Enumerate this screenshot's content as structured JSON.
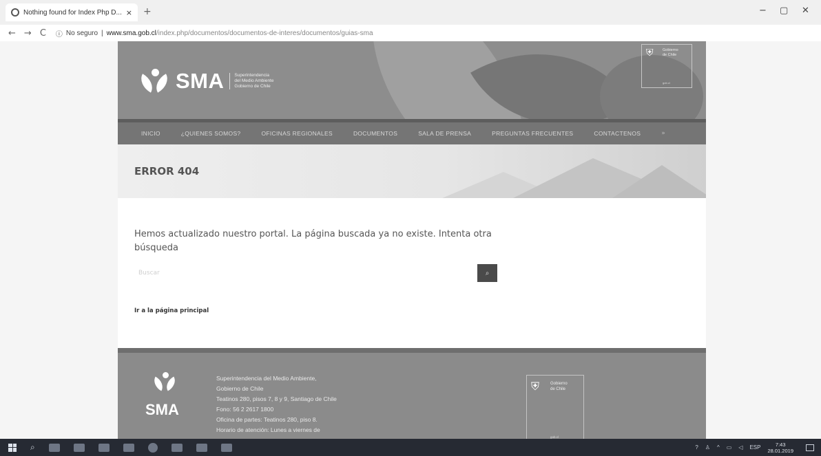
{
  "browser": {
    "tab_title": "Nothing found for Index Php D...",
    "tab_close": "×",
    "new_tab": "+",
    "win_min": "−",
    "win_max": "▢",
    "win_close": "✕",
    "back": "←",
    "forward": "→",
    "reload": "C",
    "security_label": "No seguro",
    "url_domain": "www.sma.gob.cl",
    "url_path": "/index.php/documentos/documentos-de-interes/documentos/guias-sma",
    "star": "☆",
    "ext": "▦",
    "account": "⊖",
    "menu": "⋮"
  },
  "header": {
    "logo_text": "SMA",
    "logo_sub": [
      "Superintendencia",
      "del Medio Ambiente",
      "Gobierno de Chile"
    ],
    "gov_badge": [
      "Gobierno",
      "de Chile"
    ],
    "gov_badge_foot": "gob.cl"
  },
  "nav": {
    "items": [
      "INICIO",
      "¿QUIENES SOMOS?",
      "OFICINAS REGIONALES",
      "DOCUMENTOS",
      "SALA DE PRENSA",
      "PREGUNTAS FRECUENTES",
      "CONTACTENOS"
    ],
    "more": "»"
  },
  "page": {
    "error_title": "ERROR 404",
    "message": "Hemos actualizado nuestro portal. La página buscada ya no existe. Intenta otra búsqueda",
    "search_placeholder": "Buscar",
    "search_button": "⌕",
    "home_link": "Ir a la página principal"
  },
  "footer": {
    "logo_text": "SMA",
    "address_lines": [
      "Superintendencia del Medio Ambiente,",
      "Gobierno de Chile",
      "Teatinos 280, pisos 7, 8 y 9, Santiago de Chile",
      "Fono: 56 2 2617 1800",
      "Oficina de partes: Teatinos 280, piso 8.",
      "Horario de atención: Lunes a viernes de"
    ],
    "gov_badge": [
      "Gobierno",
      "de Chile"
    ],
    "gov_badge_foot": "gob.cl"
  },
  "taskbar": {
    "language": "ESP",
    "time": "7:43",
    "date": "28.01.2019",
    "tray_icons": [
      "help",
      "people",
      "up-arrow",
      "battery",
      "network",
      "volume"
    ]
  }
}
